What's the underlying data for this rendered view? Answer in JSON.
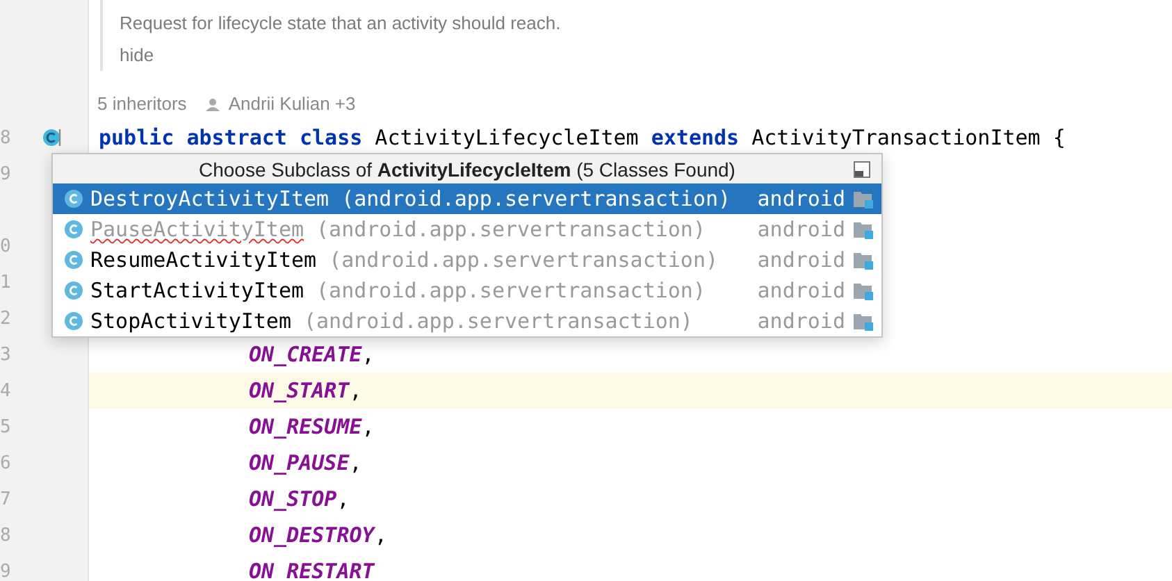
{
  "doc": {
    "text": "Request for lifecycle state that an activity should reach.",
    "link": "hide"
  },
  "inlay": {
    "inheritors": "5 inheritors",
    "author": "Andrii Kulian +3"
  },
  "lines": [
    {
      "number": "8",
      "kind": "declaration",
      "current": false,
      "gutter_icon": true,
      "tokens": [
        {
          "kind": "keyword",
          "text": "public abstract class"
        },
        {
          "kind": "plain",
          "text": " ActivityLifecycleItem "
        },
        {
          "kind": "keyword",
          "text": "extends"
        },
        {
          "kind": "plain",
          "text": " ActivityTransactionItem {"
        }
      ]
    },
    {
      "number": "9",
      "kind": "hidden",
      "current": false,
      "gutter_icon": false
    },
    {
      "kind": "hidden",
      "current": false,
      "gutter_icon": false
    },
    {
      "number": "0",
      "kind": "hidden",
      "current": false,
      "gutter_icon": false
    },
    {
      "number": "1",
      "kind": "hidden",
      "current": false,
      "gutter_icon": false
    },
    {
      "number": "2",
      "kind": "hidden",
      "current": false,
      "gutter_icon": false
    },
    {
      "number": "3",
      "kind": "constant",
      "current": false,
      "gutter_icon": false,
      "tokens": [
        {
          "kind": "constant",
          "text": "ON_CREATE"
        },
        {
          "kind": "plain",
          "text": ","
        }
      ]
    },
    {
      "number": "4",
      "kind": "constant",
      "current": true,
      "gutter_icon": false,
      "tokens": [
        {
          "kind": "constant",
          "text": "ON_START"
        },
        {
          "kind": "plain",
          "text": ","
        }
      ]
    },
    {
      "number": "5",
      "kind": "constant",
      "current": false,
      "gutter_icon": false,
      "tokens": [
        {
          "kind": "constant",
          "text": "ON_RESUME"
        },
        {
          "kind": "plain",
          "text": ","
        }
      ]
    },
    {
      "number": "6",
      "kind": "constant",
      "current": false,
      "gutter_icon": false,
      "tokens": [
        {
          "kind": "constant",
          "text": "ON_PAUSE"
        },
        {
          "kind": "plain",
          "text": ","
        }
      ]
    },
    {
      "number": "7",
      "kind": "constant",
      "current": false,
      "gutter_icon": false,
      "tokens": [
        {
          "kind": "constant",
          "text": "ON_STOP"
        },
        {
          "kind": "plain",
          "text": ","
        }
      ]
    },
    {
      "number": "8",
      "kind": "constant",
      "current": false,
      "gutter_icon": false,
      "tokens": [
        {
          "kind": "constant",
          "text": "ON_DESTROY"
        },
        {
          "kind": "plain",
          "text": ","
        }
      ]
    },
    {
      "number": "9",
      "kind": "constant",
      "current": false,
      "gutter_icon": false,
      "tokens": [
        {
          "kind": "constant",
          "text": "ON_RESTART"
        }
      ]
    }
  ],
  "popup": {
    "title": "Choose Subclass of **ActivityLifecycleItem** (5 Classes Found)",
    "items": [
      {
        "name": "DestroyActivityItem",
        "package": "(android.app.servertransaction)",
        "module": "android",
        "selected": true,
        "dimmed": false,
        "error": false
      },
      {
        "name": "PauseActivityItem",
        "package": "(android.app.servertransaction)",
        "module": "android",
        "selected": false,
        "dimmed": true,
        "error": true
      },
      {
        "name": "ResumeActivityItem",
        "package": "(android.app.servertransaction)",
        "module": "android",
        "selected": false,
        "dimmed": false,
        "error": false
      },
      {
        "name": "StartActivityItem",
        "package": "(android.app.servertransaction)",
        "module": "android",
        "selected": false,
        "dimmed": false,
        "error": false
      },
      {
        "name": "StopActivityItem",
        "package": "(android.app.servertransaction)",
        "module": "android",
        "selected": false,
        "dimmed": false,
        "error": false
      }
    ]
  }
}
